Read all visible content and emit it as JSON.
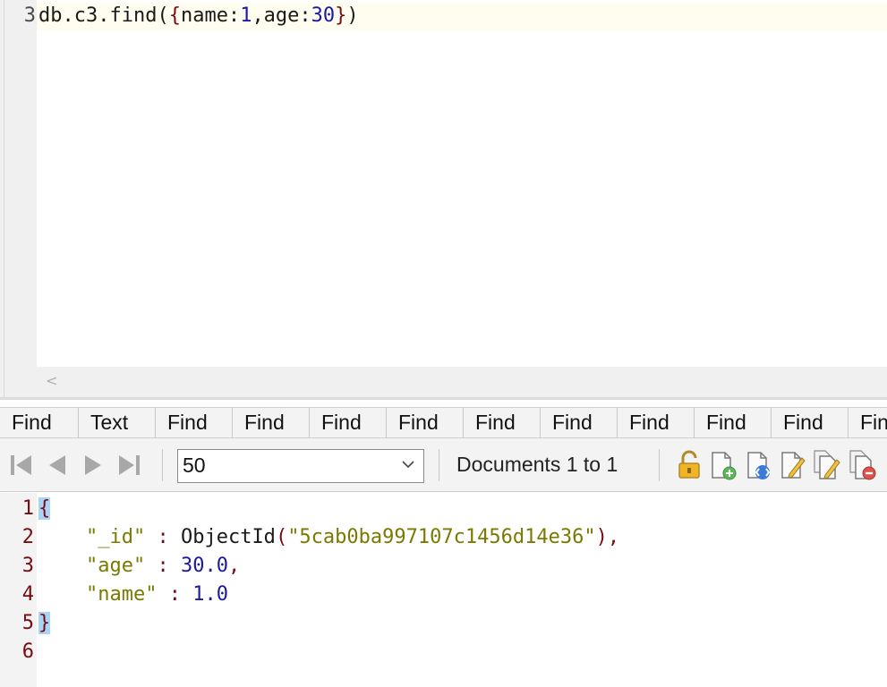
{
  "editor": {
    "line_number": "3",
    "query_parts": {
      "p1": "db.c3.find(",
      "b1": "{",
      "p2": "name:",
      "n1": "1",
      "p3": ",age:",
      "n2": "30",
      "b2": "}",
      "p4": ")"
    },
    "scroll_left_arrow": "<"
  },
  "tabs": [
    "Find",
    "Text",
    "Find",
    "Find",
    "Find",
    "Find",
    "Find",
    "Find",
    "Find",
    "Find",
    "Find",
    "Fin"
  ],
  "toolbar": {
    "page_size": "50",
    "documents_label": "Documents 1 to 1",
    "nav_icons": [
      "first-page-icon",
      "previous-page-icon",
      "next-page-icon",
      "last-page-icon"
    ],
    "action_icons": [
      "lock-icon",
      "add-document-icon",
      "view-document-icon",
      "edit-document-icon",
      "edit-multiple-icon",
      "delete-document-icon"
    ]
  },
  "result": {
    "line_numbers": [
      "1",
      "2",
      "3",
      "4",
      "5",
      "6"
    ],
    "open_brace": "{",
    "close_brace": "}",
    "id_key": "\"_id\"",
    "id_func": "ObjectId",
    "id_value": "\"5cab0ba997107c1456d14e36\"",
    "age_key": "\"age\"",
    "age_value": "30.0",
    "name_key": "\"name\"",
    "name_value": "1.0"
  },
  "colors": {
    "brace": "#7a0a12",
    "number": "#1a1aa0",
    "string": "#7a7a00",
    "bracket_highlight": "#a9d4f5"
  }
}
